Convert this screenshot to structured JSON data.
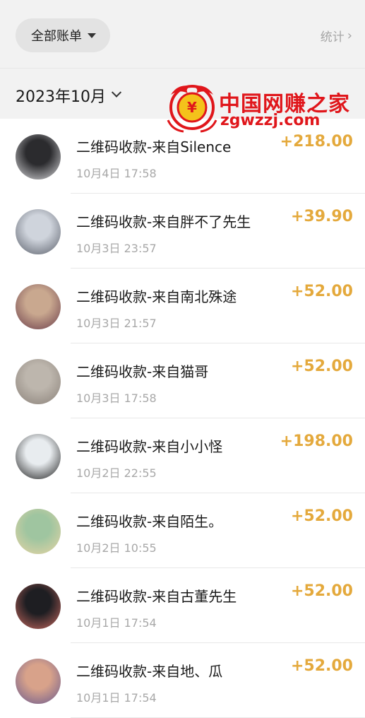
{
  "header": {
    "filter_label": "全部账单",
    "stats_label": "统计"
  },
  "month": {
    "label": "2023年10月"
  },
  "watermark": {
    "name": "中国网赚之家",
    "url": "zgwzzj.com"
  },
  "transactions": [
    {
      "title": "二维码收款-来自Silence",
      "time": "10月4日 17:58",
      "amount": "+218.00",
      "avatar_colors": [
        "#2b2b2e",
        "#d9d9dc"
      ]
    },
    {
      "title": "二维码收款-来自胖不了先生",
      "time": "10月3日 23:57",
      "amount": "+39.90",
      "avatar_colors": [
        "#cfd4dc",
        "#5a5f6a"
      ]
    },
    {
      "title": "二维码收款-来自南北殊途",
      "time": "10月3日 21:57",
      "amount": "+52.00",
      "avatar_colors": [
        "#c9a88f",
        "#6b3d4a"
      ]
    },
    {
      "title": "二维码收款-来自猫哥",
      "time": "10月3日 17:58",
      "amount": "+52.00",
      "avatar_colors": [
        "#bdb6ad",
        "#8a8179"
      ]
    },
    {
      "title": "二维码收款-来自小小怪",
      "time": "10月2日 22:55",
      "amount": "+198.00",
      "avatar_colors": [
        "#e8ecef",
        "#1f1f1f"
      ]
    },
    {
      "title": "二维码收款-来自陌生。",
      "time": "10月2日 10:55",
      "amount": "+52.00",
      "avatar_colors": [
        "#9fc5a0",
        "#e7d4a4"
      ]
    },
    {
      "title": "二维码收款-来自古董先生",
      "time": "10月1日 17:54",
      "amount": "+52.00",
      "avatar_colors": [
        "#1e1e22",
        "#c7685f"
      ]
    },
    {
      "title": "二维码收款-来自地、瓜",
      "time": "10月1日 17:54",
      "amount": "+52.00",
      "avatar_colors": [
        "#d8a28a",
        "#6a5a8f"
      ]
    }
  ],
  "colors": {
    "amount": "#e4a93c",
    "watermark": "#e0161b",
    "header_bg": "#f2f2f2"
  }
}
